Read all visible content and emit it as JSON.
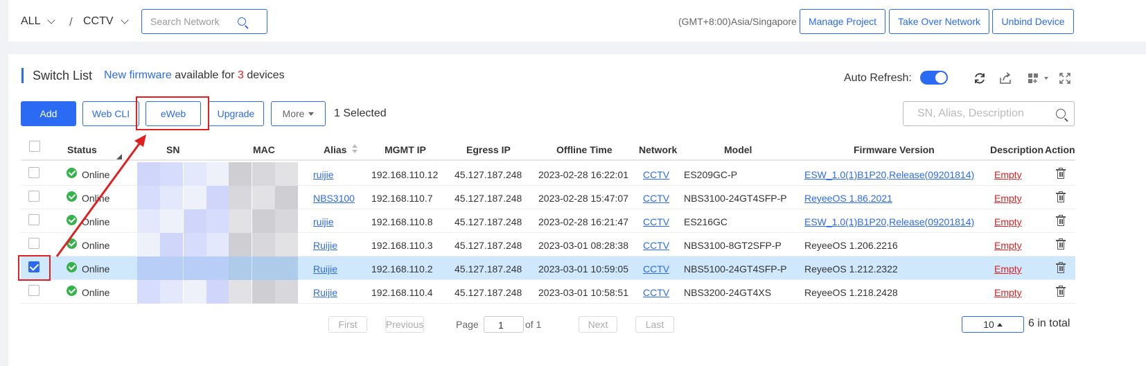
{
  "header": {
    "scope": "ALL",
    "separator": "/",
    "project": "CCTV",
    "search_placeholder": "Search Network",
    "timezone": "(GMT+8:00)Asia/Singapore",
    "buttons": [
      "Manage Project",
      "Take Over Network",
      "Unbind Device"
    ]
  },
  "panel": {
    "title": "Switch List",
    "fw_link": "New firmware",
    "fw_mid": " available for ",
    "fw_count": "3",
    "fw_tail": " devices",
    "auto_refresh": "Auto Refresh:",
    "auto_refresh_on": true
  },
  "actions": {
    "add": "Add",
    "webcli": "Web CLI",
    "eweb": "eWeb",
    "upgrade": "Upgrade",
    "more": "More",
    "selected": "1 Selected",
    "search_placeholder": "SN, Alias, Description"
  },
  "columns": [
    "Status",
    "SN",
    "MAC",
    "Alias",
    "MGMT IP",
    "Egress IP",
    "Offline Time",
    "Network",
    "Model",
    "Firmware Version",
    "Description",
    "Action"
  ],
  "rows": [
    {
      "checked": false,
      "status": "Online",
      "alias": "ruijie",
      "mgmt": "192.168.110.12",
      "egress": "45.127.187.248",
      "offline": "2023-02-28 16:22:01",
      "network": "CCTV",
      "model": "ES209GC-P",
      "fw": "ESW_1.0(1)B1P20,Release(09201814)",
      "fw_link": true,
      "desc": "Empty"
    },
    {
      "checked": false,
      "status": "Online",
      "alias": "NBS3100",
      "mgmt": "192.168.110.7",
      "egress": "45.127.187.248",
      "offline": "2023-02-28 15:47:07",
      "network": "CCTV",
      "model": "NBS3100-24GT4SFP-P",
      "fw": "ReyeeOS 1.86.2021",
      "fw_link": true,
      "desc": "Empty"
    },
    {
      "checked": false,
      "status": "Online",
      "alias": "ruijie",
      "mgmt": "192.168.110.8",
      "egress": "45.127.187.248",
      "offline": "2023-02-28 16:21:47",
      "network": "CCTV",
      "model": "ES216GC",
      "fw": "ESW_1.0(1)B1P20,Release(09201814)",
      "fw_link": true,
      "desc": "Empty"
    },
    {
      "checked": false,
      "status": "Online",
      "alias": "Ruijie",
      "mgmt": "192.168.110.3",
      "egress": "45.127.187.248",
      "offline": "2023-03-01 08:28:38",
      "network": "CCTV",
      "model": "NBS3100-8GT2SFP-P",
      "fw": "ReyeeOS 1.206.2216",
      "fw_link": false,
      "desc": "Empty"
    },
    {
      "checked": true,
      "status": "Online",
      "alias": "Ruijie",
      "mgmt": "192.168.110.2",
      "egress": "45.127.187.248",
      "offline": "2023-03-01 10:59:05",
      "network": "CCTV",
      "model": "NBS5100-24GT4SFP-P",
      "fw": "ReyeeOS 1.212.2322",
      "fw_link": false,
      "desc": "Empty"
    },
    {
      "checked": false,
      "status": "Online",
      "alias": "Ruijie",
      "mgmt": "192.168.110.4",
      "egress": "45.127.187.248",
      "offline": "2023-03-01 10:58:51",
      "network": "CCTV",
      "model": "NBS3200-24GT4XS",
      "fw": "ReyeeOS 1.218.2428",
      "fw_link": false,
      "desc": "Empty"
    }
  ],
  "pagination": {
    "first": "First",
    "previous": "Previous",
    "page_label": "Page",
    "page": "1",
    "of": "of 1",
    "next": "Next",
    "last": "Last",
    "page_size": "10",
    "total": "6 in total"
  },
  "colors": {
    "accent": "#2b6bf3",
    "online": "#34b34a",
    "warning": "#e02020",
    "selected_row": "#cfe8fb"
  }
}
